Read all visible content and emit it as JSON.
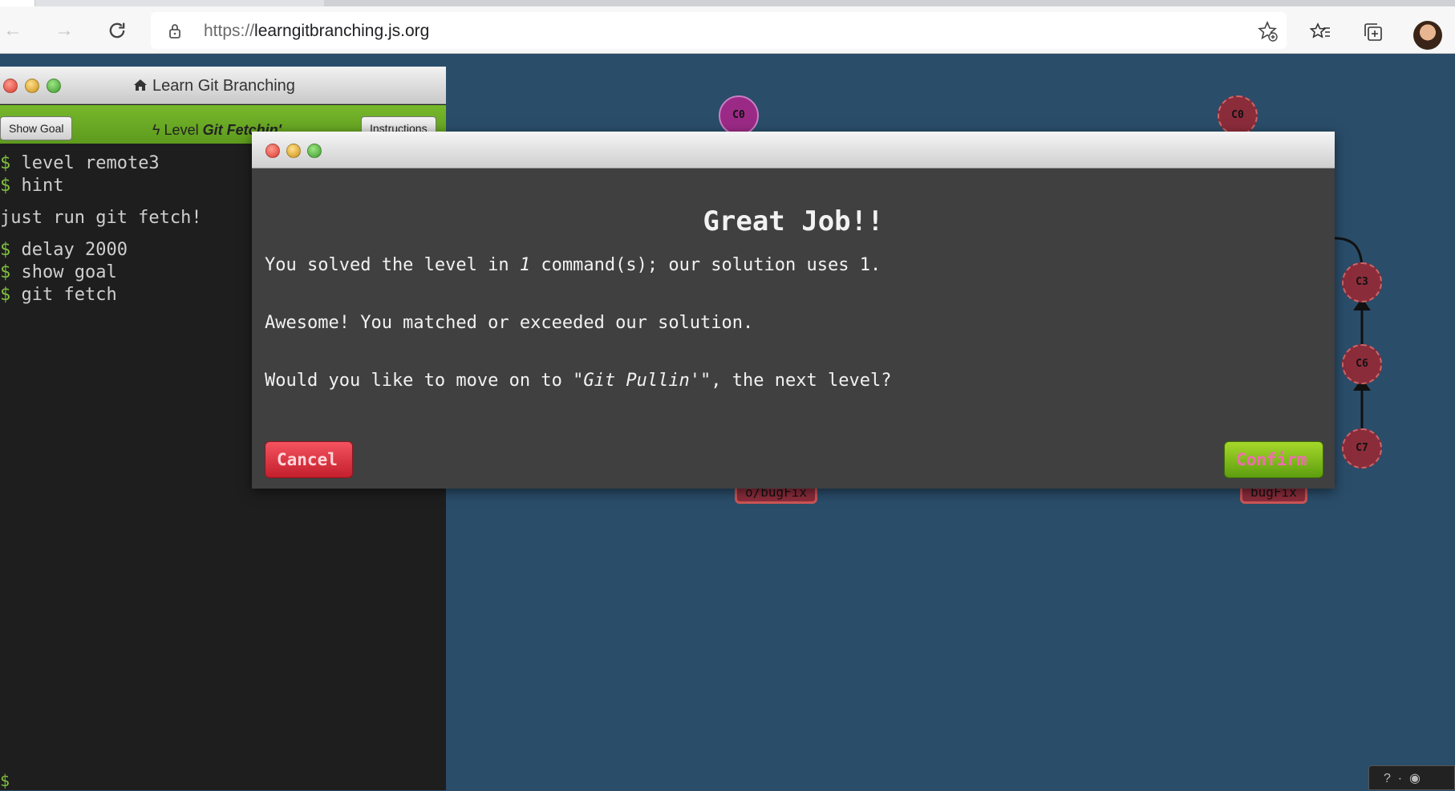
{
  "browser": {
    "url_scheme": "https://",
    "url_host": "learngitbranching.js.org",
    "icons": [
      "back-arrow-icon",
      "forward-arrow-icon",
      "reload-icon",
      "lock-icon",
      "add-favorite-icon",
      "favorites-icon",
      "collections-icon",
      "profile-avatar"
    ]
  },
  "terminal": {
    "title": "Learn Git Branching",
    "show_goal_label": "Show Goal",
    "level_prefix": "Level",
    "level_name": "Git Fetchin'",
    "instructions_label": "Instructions",
    "lines": [
      {
        "prompt": "$",
        "text": " level remote3"
      },
      {
        "prompt": "$",
        "text": " hint"
      },
      {
        "prompt": "",
        "text": "just run git fetch!"
      },
      {
        "prompt": "$",
        "text": " delay 2000"
      },
      {
        "prompt": "$",
        "text": " show goal"
      },
      {
        "prompt": "$",
        "text": " git fetch"
      }
    ],
    "caret": "$"
  },
  "tree": {
    "commits": [
      "C0",
      "C0",
      "C3",
      "C6",
      "C7"
    ],
    "branches": [
      "o/bugFix",
      "bugFix"
    ]
  },
  "modal": {
    "heading": "Great Job!!",
    "solved_prefix": "You solved the level in ",
    "solved_count": "1",
    "solved_suffix": " command(s); our solution uses 1.",
    "awesome": "Awesome! You matched or exceeded our solution.",
    "next_prefix": "Would you like to move on to ",
    "next_level": "\"Git Pullin'\"",
    "next_suffix": ", the next level?",
    "cancel_label": "Cancel",
    "confirm_label": "Confirm"
  },
  "colors": {
    "background": "#2a4d6a",
    "terminal_bg": "#1e1e1e",
    "modal_bg": "#404040",
    "confirm_green": "#7fbf1f",
    "cancel_red": "#e0323f"
  }
}
